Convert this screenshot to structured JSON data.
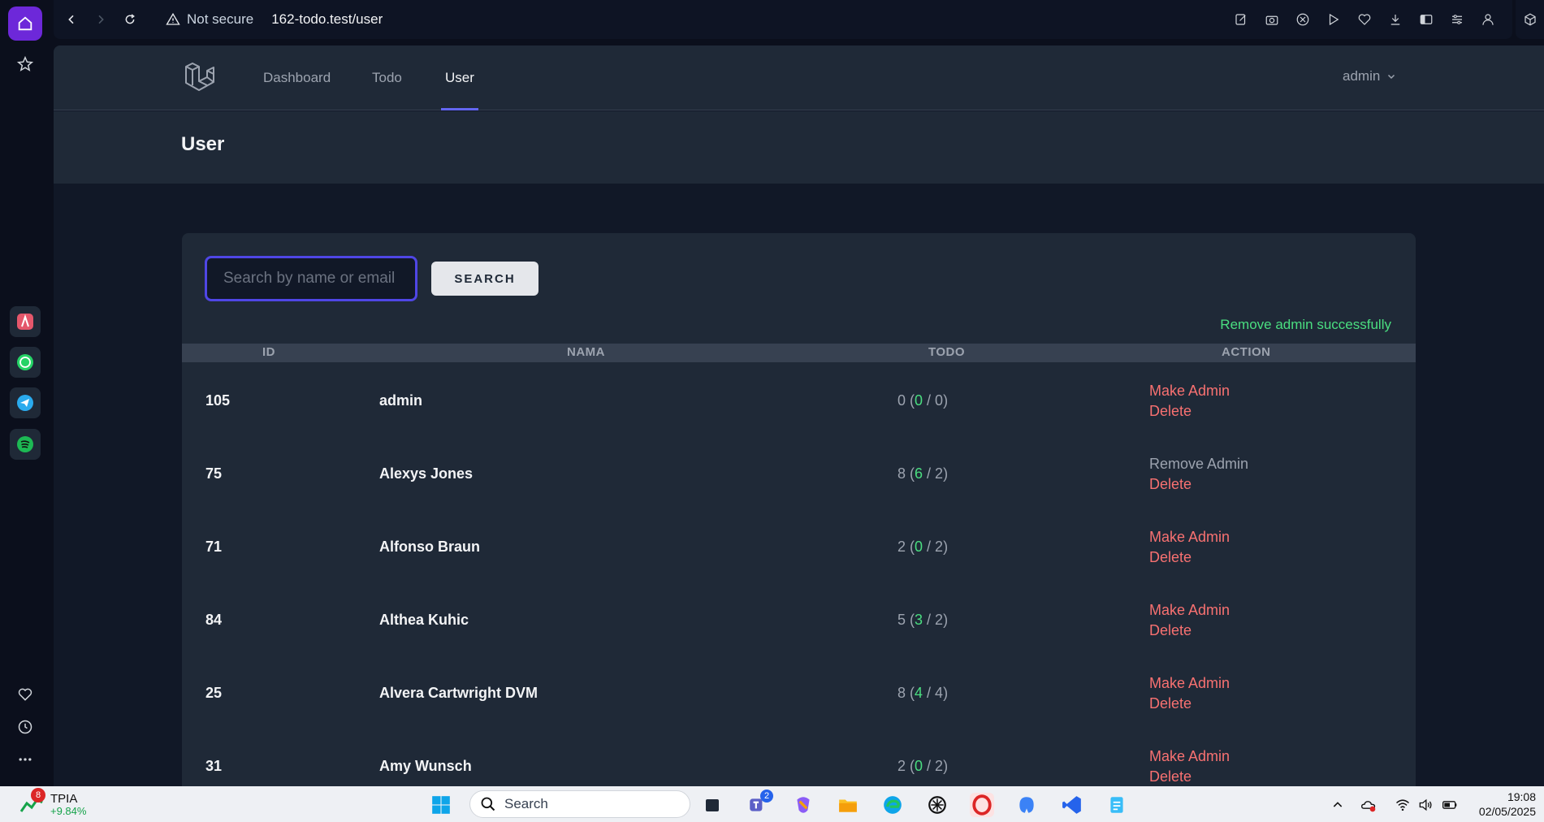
{
  "browser": {
    "security_label": "Not secure",
    "url": "162-todo.test/user"
  },
  "nav": {
    "links": [
      "Dashboard",
      "Todo",
      "User"
    ],
    "active": "User",
    "user_menu": "admin"
  },
  "header": {
    "title": "User"
  },
  "search": {
    "placeholder": "Search by name or email",
    "button_label": "SEARCH"
  },
  "flash_message": "Remove admin successfully",
  "table": {
    "headers": [
      "ID",
      "NAMA",
      "TODO",
      "ACTION"
    ],
    "rows": [
      {
        "id": "105",
        "name": "admin",
        "todo_total": "0",
        "todo_done": "0",
        "todo_pending": "0",
        "admin_action": "Make Admin",
        "delete_action": "Delete"
      },
      {
        "id": "75",
        "name": "Alexys Jones",
        "todo_total": "8",
        "todo_done": "6",
        "todo_pending": "2",
        "admin_action": "Remove Admin",
        "delete_action": "Delete"
      },
      {
        "id": "71",
        "name": "Alfonso Braun",
        "todo_total": "2",
        "todo_done": "0",
        "todo_pending": "2",
        "admin_action": "Make Admin",
        "delete_action": "Delete"
      },
      {
        "id": "84",
        "name": "Althea Kuhic",
        "todo_total": "5",
        "todo_done": "3",
        "todo_pending": "2",
        "admin_action": "Make Admin",
        "delete_action": "Delete"
      },
      {
        "id": "25",
        "name": "Alvera Cartwright DVM",
        "todo_total": "8",
        "todo_done": "4",
        "todo_pending": "4",
        "admin_action": "Make Admin",
        "delete_action": "Delete"
      },
      {
        "id": "31",
        "name": "Amy Wunsch",
        "todo_total": "2",
        "todo_done": "0",
        "todo_pending": "2",
        "admin_action": "Make Admin",
        "delete_action": "Delete"
      }
    ]
  },
  "taskbar": {
    "stock_badge": "8",
    "stock_name": "TPIA",
    "stock_change": "+9.84%",
    "search_label": "Search",
    "teams_badge": "2",
    "time": "19:08",
    "date": "02/05/2025"
  },
  "colors": {
    "accent": "#6366f1",
    "success": "#4ade80",
    "danger": "#f87171",
    "surface": "#1f2937",
    "background": "#111827"
  }
}
